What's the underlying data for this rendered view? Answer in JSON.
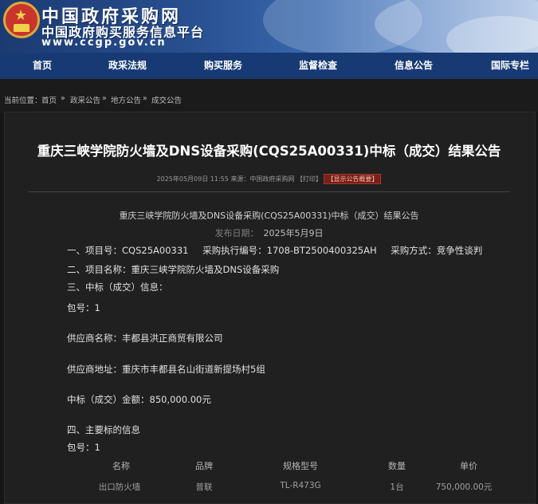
{
  "site": {
    "title": "中国政府采购网",
    "subtitle": "中国政府购买服务信息平台",
    "url": "www.ccgp.gov.cn"
  },
  "nav": [
    "首页",
    "政采法规",
    "购买服务",
    "监督检查",
    "信息公告",
    "国际专栏"
  ],
  "breadcrumb": {
    "label": "当前位置：",
    "items": [
      "首页",
      "政采公告",
      "地方公告",
      "成交公告"
    ],
    "separator": "»"
  },
  "article": {
    "title": "重庆三峡学院防火墙及DNS设备采购(CQS25A00331)中标（成交）结果公告",
    "meta_time": "2025年05月09日 11:55",
    "meta_source": "来源：中国政府采购网",
    "print_label": "【打印】",
    "summary_label": "【显示公告概要】",
    "subtitle": "重庆三峡学院防火墙及DNS设备采购(CQS25A00331)中标（成交）结果公告",
    "publish_label": "发布日期：",
    "publish_date": "2025年5月9日",
    "section1_prefix": "一、项目号：",
    "project_no": "CQS25A00331",
    "exec_no_label": "采购执行编号：",
    "exec_no": "1708-BT2500400325AH",
    "method_label": "采购方式：",
    "method": "竞争性谈判",
    "section2": "二、项目名称：",
    "project_name": "重庆三峡学院防火墙及DNS设备采购",
    "section3": "三、中标（成交）信息：",
    "package_label": "包号：",
    "package_no": "1",
    "supplier_label": "供应商名称：",
    "supplier_name": "丰都县洪正商贸有限公司",
    "address_label": "供应商地址：",
    "address": "重庆市丰都县名山街道新提场村5组",
    "amount_label": "中标（成交）金额：",
    "amount": "850,000.00元",
    "section4": "四、主要标的信息",
    "package2_label": "包号：",
    "package2_no": "1"
  },
  "items_table": {
    "headers": [
      "名称",
      "品牌",
      "规格型号",
      "数量",
      "单价"
    ],
    "rows": [
      [
        "出口防火墙",
        "普联",
        "TL-R473G",
        "1台",
        "750,000.00元"
      ]
    ]
  },
  "colors": {
    "header_blue": "#1c3a72",
    "nav_blue": "#173a74",
    "badge_red": "#7a1e18",
    "page_bg": "#161616"
  }
}
